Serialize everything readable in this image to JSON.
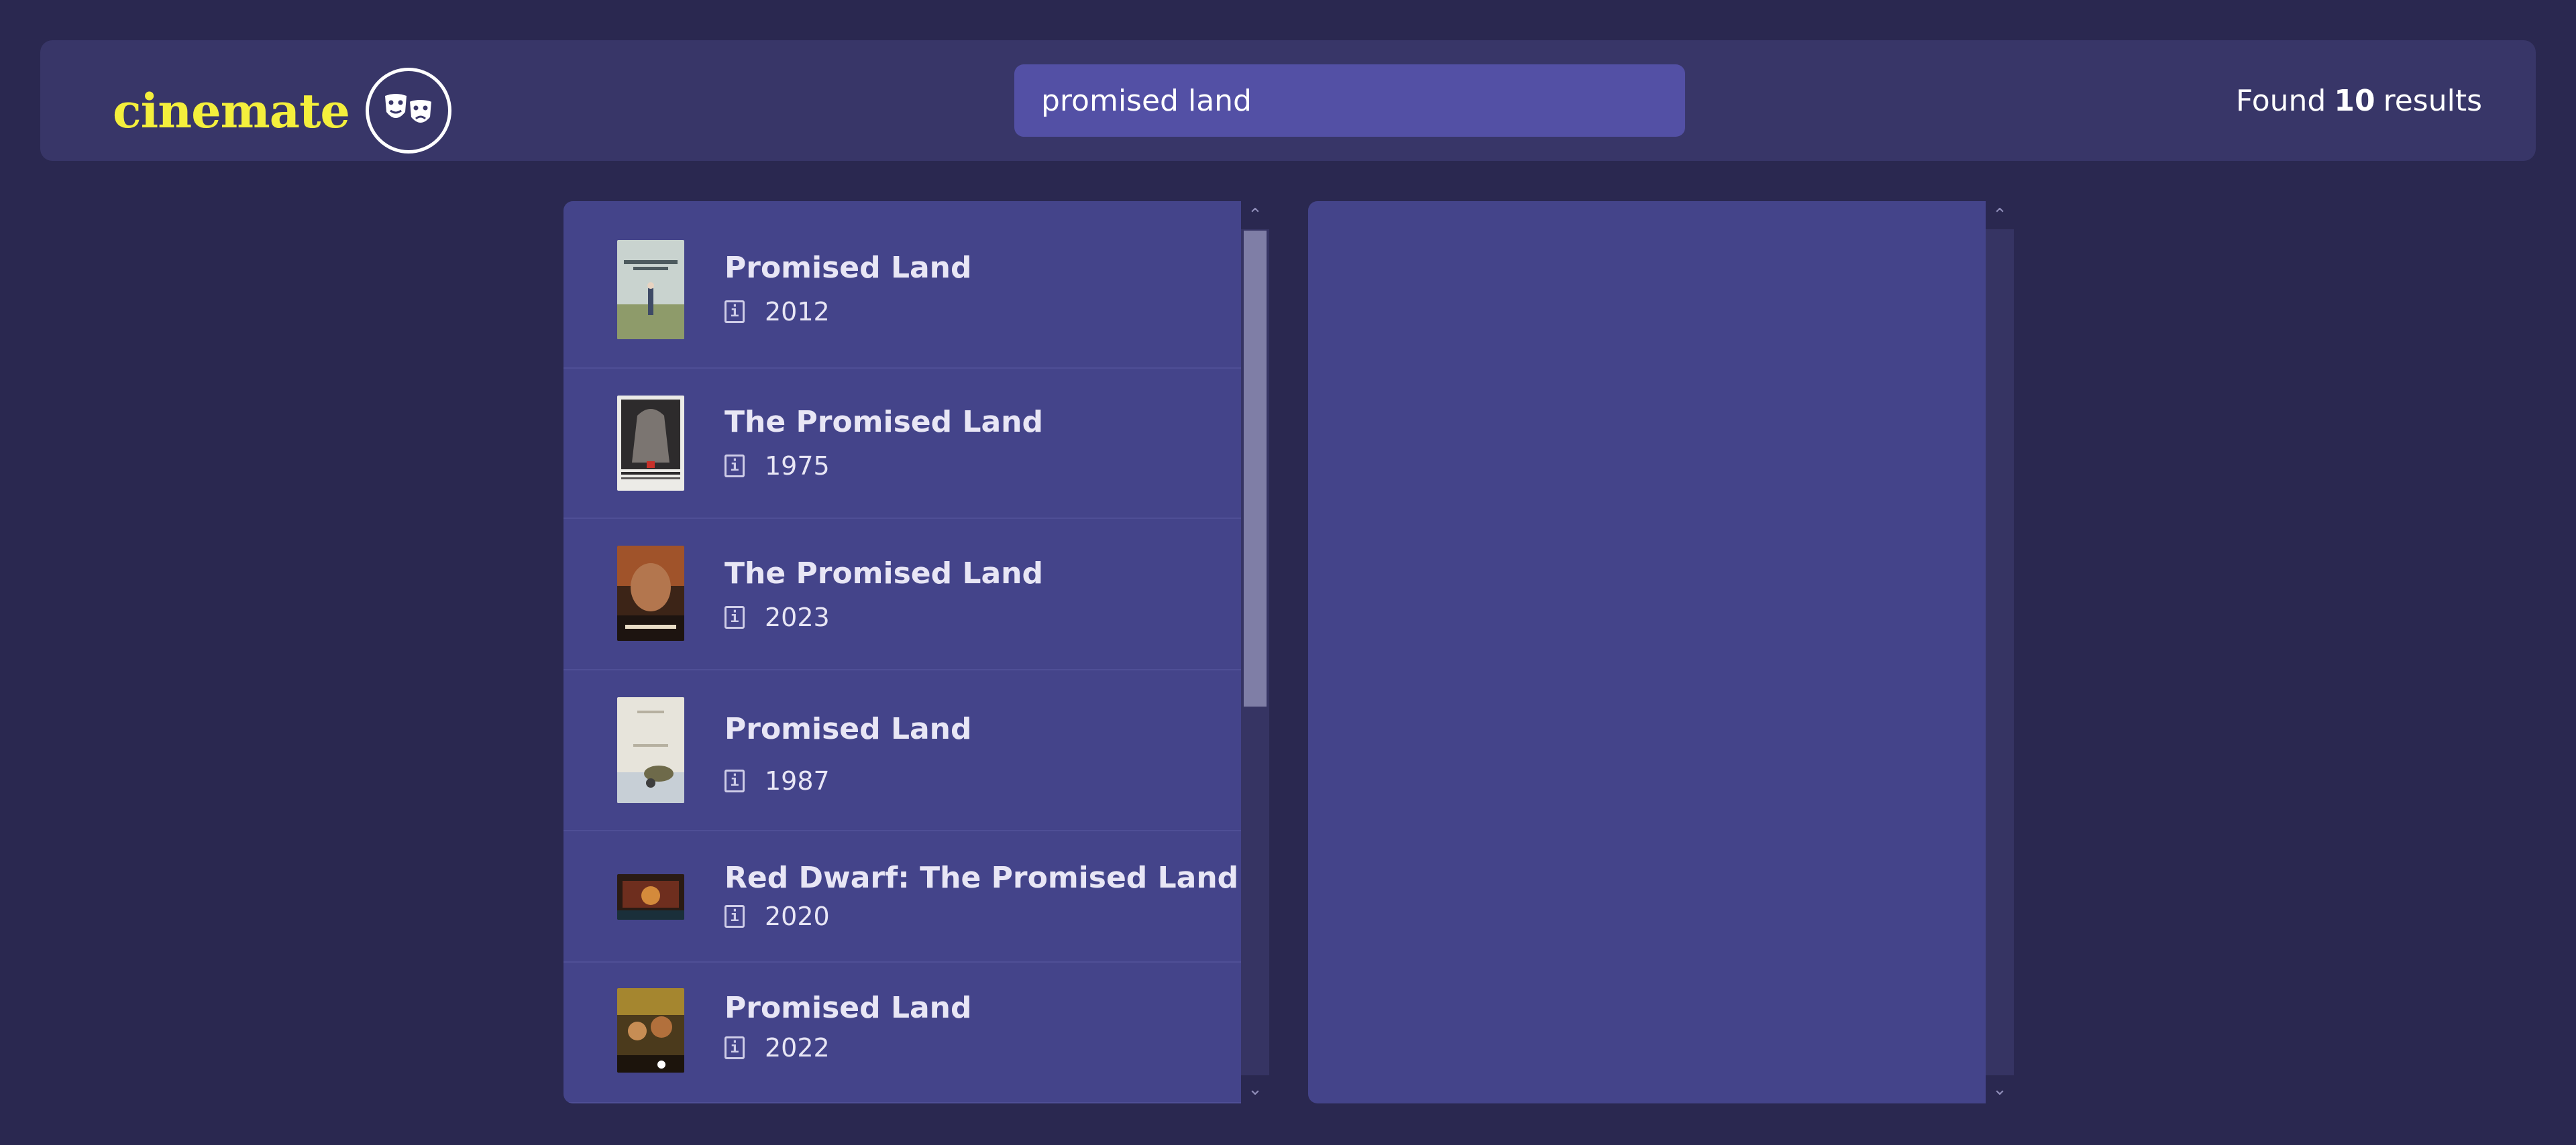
{
  "app": {
    "logo_text": "cinemate",
    "logo_icon": "theater-masks-icon",
    "brand_color": "#f4ef3c"
  },
  "search": {
    "value": "promised land"
  },
  "results": {
    "prefix": "Found",
    "count": "10",
    "suffix": "results"
  },
  "items": [
    {
      "title": "Promised Land",
      "year": "2012",
      "icon": "info-icon"
    },
    {
      "title": "The Promised Land",
      "year": "1975",
      "icon": "info-icon"
    },
    {
      "title": "The Promised Land",
      "year": "2023",
      "icon": "info-icon"
    },
    {
      "title": "Promised Land",
      "year": "1987",
      "icon": "info-icon"
    },
    {
      "title": "Red Dwarf: The Promised Land",
      "year": "2020",
      "icon": "info-icon"
    },
    {
      "title": "Promised Land",
      "year": "2022",
      "icon": "info-icon"
    }
  ],
  "colors": {
    "background": "#2a2850",
    "header": "#383668",
    "panel": "#44448a",
    "search_bg": "#5350a5"
  }
}
